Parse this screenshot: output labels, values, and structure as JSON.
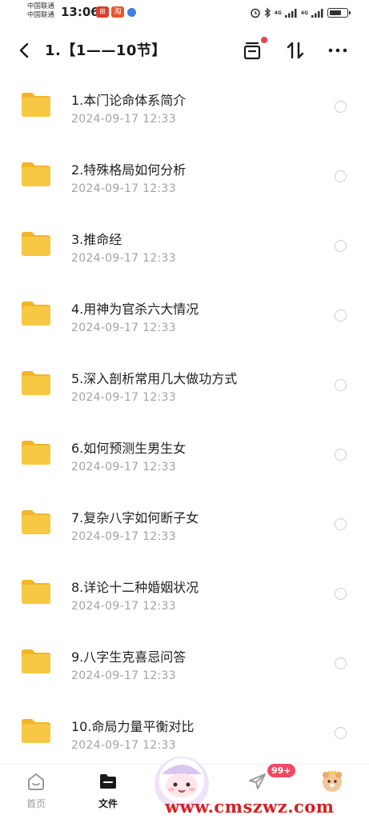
{
  "status_bar": {
    "carrier_1": "中国联通",
    "carrier_2": "中国联通",
    "time": "13:06",
    "signal_1": "4G",
    "signal_2": "4G",
    "battery_level": 0.7
  },
  "header": {
    "title": "1.【1——10节】",
    "icons": [
      "back-icon",
      "transfer-list-icon",
      "sort-icon",
      "more-icon"
    ]
  },
  "files": [
    {
      "name": "1.本门论命体系简介",
      "date": "2024-09-17  12:33"
    },
    {
      "name": "2.特殊格局如何分析",
      "date": "2024-09-17  12:33"
    },
    {
      "name": "3.推命经",
      "date": "2024-09-17  12:33"
    },
    {
      "name": "4.用神为官杀六大情况",
      "date": "2024-09-17  12:33"
    },
    {
      "name": "5.深入剖析常用几大做功方式",
      "date": "2024-09-17  12:33"
    },
    {
      "name": "6.如何预测生男生女",
      "date": "2024-09-17  12:33"
    },
    {
      "name": "7.复杂八字如何断子女",
      "date": "2024-09-17  12:33"
    },
    {
      "name": "8.详论十二种婚姻状况",
      "date": "2024-09-17  12:33"
    },
    {
      "name": "9.八字生克喜忌问答",
      "date": "2024-09-17  12:33"
    },
    {
      "name": "10.命局力量平衡对比",
      "date": "2024-09-17  12:33"
    }
  ],
  "bottom_nav": {
    "home_label": "首页",
    "files_label": "文件",
    "messages_badge": "99+",
    "active": "文件"
  },
  "watermark": "www.cmszwz.com",
  "colors": {
    "folder": "#f7c843",
    "folder_tab": "#f2b529",
    "date_text": "#a3a3a3",
    "badge": "#ef4a64",
    "watermark": "#d61f1f"
  }
}
